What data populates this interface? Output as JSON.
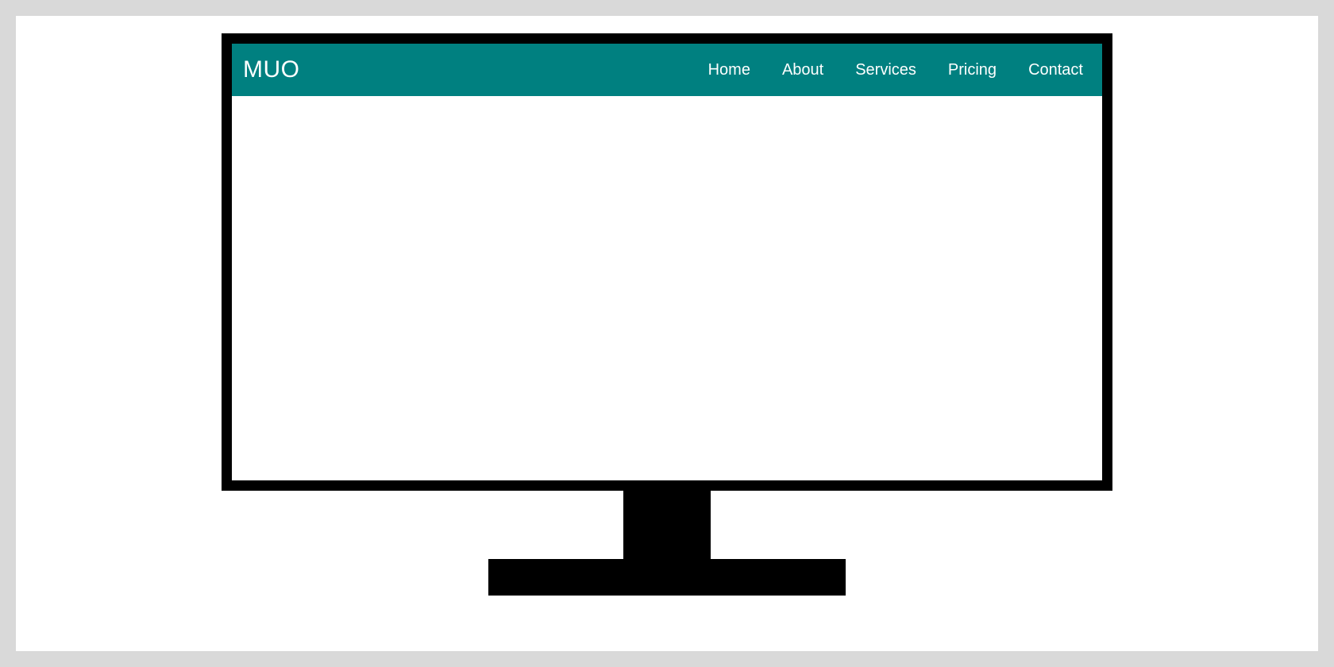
{
  "colors": {
    "page_bg": "#d9d9d9",
    "canvas_bg": "#ffffff",
    "monitor_frame": "#000000",
    "navbar_bg": "#008080",
    "nav_text": "#ffffff"
  },
  "navbar": {
    "brand": "MUO",
    "links": [
      {
        "label": "Home"
      },
      {
        "label": "About"
      },
      {
        "label": "Services"
      },
      {
        "label": "Pricing"
      },
      {
        "label": "Contact"
      }
    ]
  }
}
